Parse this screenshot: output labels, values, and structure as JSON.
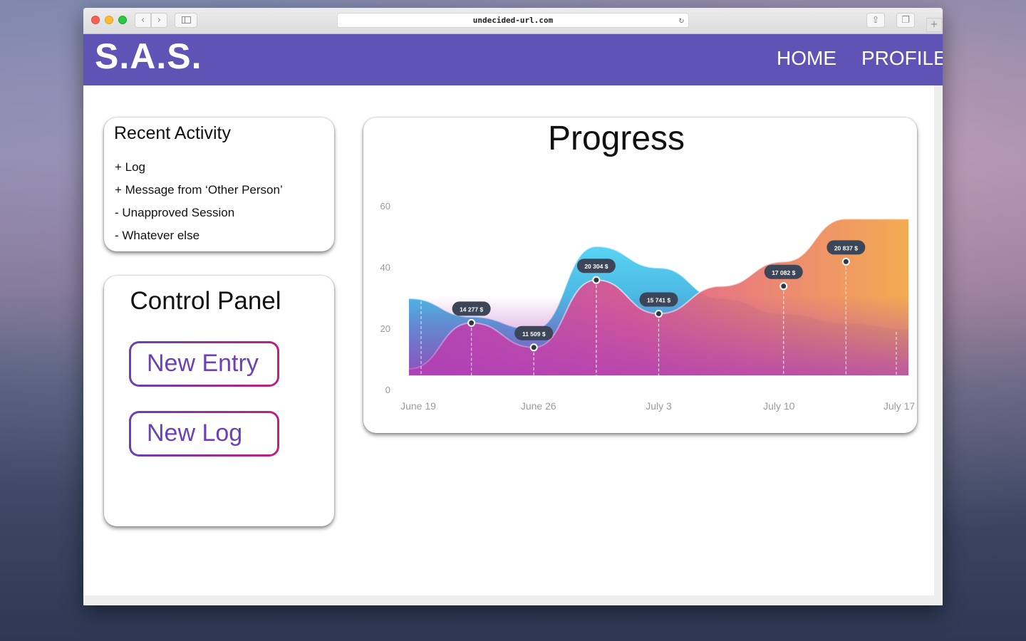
{
  "browser": {
    "url": "undecided-url.com",
    "reload_glyph": "↻",
    "back_glyph": "‹",
    "forward_glyph": "›",
    "share_glyph": "⇪",
    "tabs_glyph": "❐",
    "newtab_glyph": "+"
  },
  "navbar": {
    "logo": "S.A.S.",
    "links": [
      "HOME",
      "PROFILE"
    ],
    "background": "#5f53b5"
  },
  "recent_activity": {
    "title": "Recent Activity",
    "items": [
      "+ Log",
      "+ Message from ‘Other Person’",
      "- Unapproved Session",
      "- Whatever else"
    ]
  },
  "control_panel": {
    "title": "Control Panel",
    "buttons": [
      "New Entry",
      "New Log"
    ]
  },
  "progress": {
    "title": "Progress"
  },
  "chart_data": {
    "type": "area",
    "x": [
      "June 19",
      "June 22",
      "June 26",
      "June 29",
      "July 3",
      "July 7",
      "July 10",
      "July 14",
      "July 17"
    ],
    "tick_labels_x": [
      "June 19",
      "June 26",
      "July 3",
      "July 10",
      "July 17"
    ],
    "ylim": [
      0,
      60
    ],
    "yticks": [
      0,
      20,
      40,
      60
    ],
    "series": [
      {
        "color": "#3aa7e0",
        "values": [
          30,
          24,
          20,
          47,
          40,
          30,
          25,
          22,
          20
        ]
      },
      {
        "color": "#e9588f",
        "values": [
          7,
          22,
          14,
          36,
          25,
          34,
          42,
          56,
          56
        ]
      }
    ],
    "markers": [
      {
        "x": "June 22",
        "y": 22,
        "label": "14 277 $"
      },
      {
        "x": "June 26",
        "y": 14,
        "label": "11 509 $"
      },
      {
        "x": "June 29",
        "y": 36,
        "label": "20 304 $"
      },
      {
        "x": "July 3",
        "y": 25,
        "label": "15 741 $"
      },
      {
        "x": "July 10",
        "y": 34,
        "label": "17 082 $"
      },
      {
        "x": "July 14",
        "y": 42,
        "label": "20 837 $"
      }
    ],
    "grid": false
  }
}
